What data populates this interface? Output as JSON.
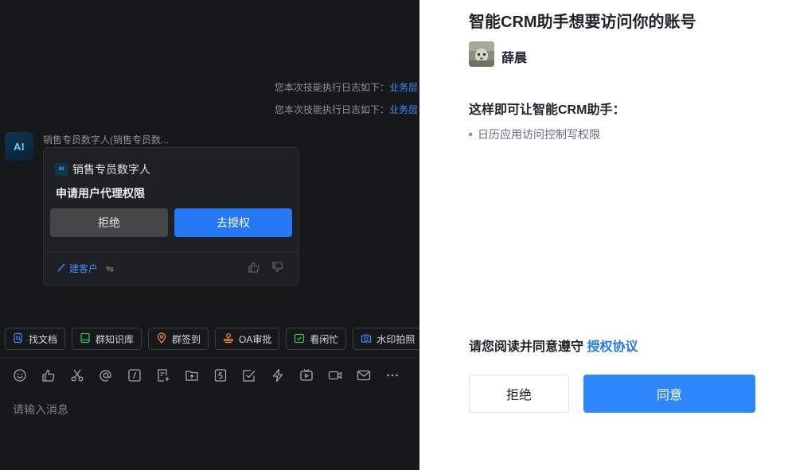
{
  "chat": {
    "log_lines": [
      {
        "prefix": "您本次技能执行日志如下：",
        "link": "业务层"
      },
      {
        "prefix": "您本次技能执行日志如下：",
        "link": "业务层"
      }
    ],
    "bot": {
      "avatar_text": "AI",
      "name": "销售专员数字人(销售专员数..."
    },
    "card": {
      "app_icon_text": "AI",
      "app_name": "销售专员数字人",
      "title": "申请用户代理权限",
      "reject_label": "拒绝",
      "authorize_label": "去授权",
      "footer_link": "建客户",
      "footer_swap": "⇋"
    },
    "quick_actions": [
      {
        "label": "找文档",
        "icon": "doc-search-icon",
        "color": "#3d8bff"
      },
      {
        "label": "群知识库",
        "icon": "knowledge-icon",
        "color": "#34c759"
      },
      {
        "label": "群签到",
        "icon": "location-icon",
        "color": "#ff8a3d"
      },
      {
        "label": "OA审批",
        "icon": "stamp-icon",
        "color": "#ff8a3d"
      },
      {
        "label": "看闲忙",
        "icon": "calendar-check-icon",
        "color": "#34c759"
      },
      {
        "label": "水印拍照",
        "icon": "camera-icon",
        "color": "#3d8bff"
      }
    ],
    "toolbar_icons": [
      "emoji-icon",
      "thumbs-up-icon",
      "scissors-icon",
      "at-icon",
      "slash-command-icon",
      "doc-add-icon",
      "folder-upload-icon",
      "number-five-icon",
      "task-check-icon",
      "lightning-icon",
      "tv-icon",
      "video-icon",
      "mail-icon",
      "more-icon"
    ],
    "input_placeholder": "请输入消息"
  },
  "auth": {
    "title": "智能CRM助手想要访问你的账号",
    "user_name": "薛晨",
    "perm_title": "这样即可让智能CRM助手：",
    "permissions": [
      "日历应用访问控制写权限"
    ],
    "agree_prefix": "请您阅读并同意遵守 ",
    "agree_link": "授权协议",
    "reject_label": "拒绝",
    "agree_label": "同意"
  }
}
